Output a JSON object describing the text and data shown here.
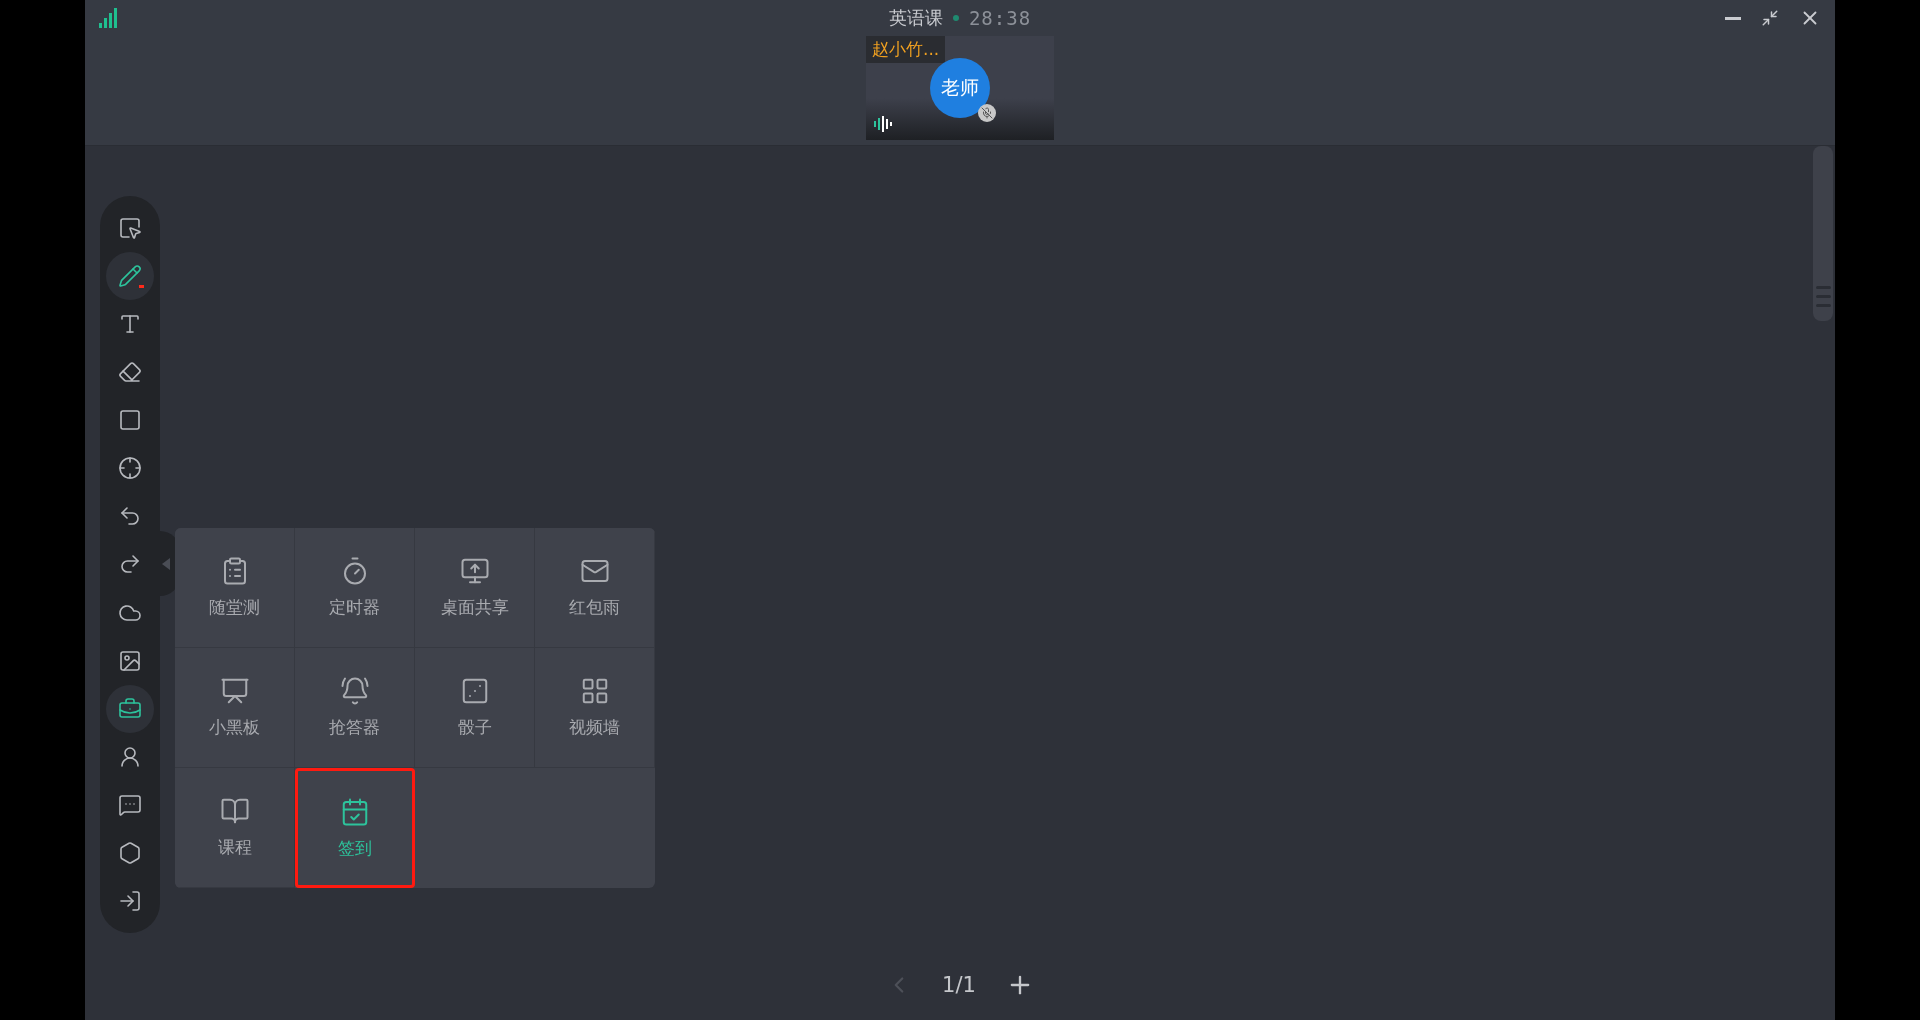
{
  "header": {
    "title": "英语课",
    "timer": "28:38"
  },
  "video_tile": {
    "name": "赵小竹...",
    "avatar": "老师"
  },
  "toolbar": [
    {
      "selected": false
    },
    {
      "selected": true
    },
    {
      "selected": false
    },
    {
      "selected": false
    },
    {
      "selected": false
    },
    {
      "selected": false
    },
    {
      "selected": false
    },
    {
      "selected": false
    },
    {
      "selected": false
    },
    {
      "selected": false
    },
    {
      "selected": true
    },
    {
      "selected": false
    },
    {
      "selected": false
    },
    {
      "selected": false
    },
    {
      "selected": false
    }
  ],
  "tool_panel": [
    {
      "label": "随堂测",
      "selected": false
    },
    {
      "label": "定时器",
      "selected": false
    },
    {
      "label": "桌面共享",
      "selected": false
    },
    {
      "label": "红包雨",
      "selected": false
    },
    {
      "label": "小黑板",
      "selected": false
    },
    {
      "label": "抢答器",
      "selected": false
    },
    {
      "label": "骰子",
      "selected": false
    },
    {
      "label": "视频墙",
      "selected": false
    },
    {
      "label": "课程",
      "selected": false
    },
    {
      "label": "签到",
      "selected": true
    }
  ],
  "pagination": {
    "page": "1/1"
  }
}
